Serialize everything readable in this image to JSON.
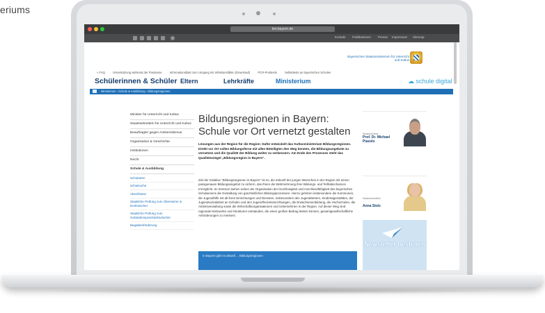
{
  "caption": "eriums",
  "browser": {
    "url": "km.bayern.de",
    "toolbar_links": [
      "Kontakt",
      "Publikationen",
      "Presse",
      "Impressum",
      "Sitemap"
    ]
  },
  "header": {
    "logo_text": "Bayerisches Staatsministerium für Unterricht und Kultus",
    "quicklinks": [
      "» FAQ",
      "Unterstützung während der Pandemie",
      "Informationsblatt zum Umgang mit Infektionsfällen (Download)",
      "PCR-Pooltests",
      "Selbsttests an bayerischen Schulen"
    ],
    "nav": [
      "Schülerinnen & Schüler",
      "Eltern",
      "Lehrkräfte",
      "Ministerium"
    ],
    "nav_right": "schule digital",
    "breadcrumb": "Ministerium  ›  Schule & Ausbildung  ›  Bildungsregionen"
  },
  "sidebar": {
    "items": [
      {
        "label": "Minister für Unterricht und Kultus",
        "bold": false
      },
      {
        "label": "Staatssekretärin für Unterricht und Kultus",
        "bold": false
      },
      {
        "label": "Beauftragter gegen Antisemitismus",
        "bold": false
      },
      {
        "label": "Organisation & Geschichte",
        "bold": false
      },
      {
        "label": "Institutionen",
        "bold": false
      },
      {
        "label": "Recht",
        "bold": false
      },
      {
        "label": "Schule & Ausbildung",
        "bold": true
      }
    ],
    "subitems": [
      "Schularten",
      "Schulsuche",
      "Abschlüsse",
      "Staatliche Prüfung zum Übersetzer & Dolmetscher",
      "Staatliche Prüfung zum Gebärdensprachdolmetscher",
      "Begabtenförderung"
    ]
  },
  "article": {
    "title": "Bildungsregionen in Bayern: Schule vor Ort vernetzt gestalten",
    "lead": "Lösungen aus der Region für die Region: Dafür entwickelt das Kultusministerium Bildungsregionen. Direkt vor Ort sollen Bildungsferne mit allen Beteiligten den Weg beraten, die Bildungsangebote zu vernetzen und die Qualität der Bildung weiter zu verbessern. Am Ende des Prozesses steht das Qualitätssiegel „Bildungsregion in Bayern“.",
    "body": "Ziel der Initiative \"Bildungsregionen in Bayern\" ist es, die Zukunft der jungen Menschen in der Region mit einem passgenauen Bildungsangebot zu sichern, das ihnen die Wahrnehmung ihrer Bildungs- und Teilhabechancen ermöglicht. Im Zentrum stehen neben der Organisation der bruchlosigkeit und Anschlussfähigkeit des bayerischen Schulwesens die Gestaltung von ganzheitlichen Bildungsprozessen. Hierzu gehören insbesondere die Kommunen, die Jugendhilfe mit all ihren Einrichtungen und Diensten, insbesondere den Jugendämtern, Kindertagesstätten, der Jugendsozialarbeit an Schulen und den Jugendfreizeiteinrichtungen, die Erwachsenenbildung, die Hochschulen, die Arbeitsverwaltung sowie die Wirtschaftsorganisationen und Unternehmen in der Region. Auf dieser Weg sind regionale Netzwerke und Strukturen entstanden, die einen großen Beitrag leisten können, gesamtgesellschaftliche Anforderungen zu meistern.",
    "bluebox": "In Bayern gibt es aktuell ... Bildungsregionen"
  },
  "rightcol": {
    "people": [
      {
        "function": "Staatsminister",
        "name": "Prof. Dr. Michael Piazolo"
      },
      {
        "function": "Staatssekretärin",
        "name": "Anna Stolz"
      }
    ],
    "newsletter": "Newsletter bestellen"
  },
  "colors": {
    "brand": "#153e6e",
    "accent": "#1d6fb8",
    "breadcrumb": "#1f6fb6",
    "newsletter_bg": "#cfe3f3"
  }
}
